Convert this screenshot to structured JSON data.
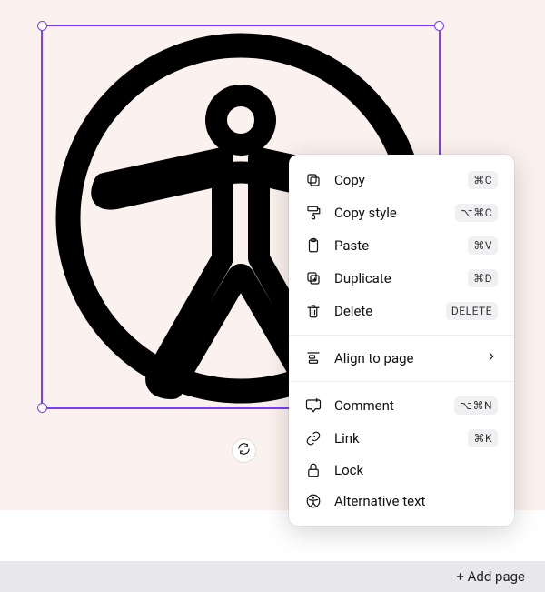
{
  "menu": {
    "copy": {
      "label": "Copy",
      "shortcut": "⌘C"
    },
    "copy_style": {
      "label": "Copy style",
      "shortcut": "⌥⌘C"
    },
    "paste": {
      "label": "Paste",
      "shortcut": "⌘V"
    },
    "duplicate": {
      "label": "Duplicate",
      "shortcut": "⌘D"
    },
    "delete": {
      "label": "Delete",
      "shortcut": "DELETE"
    },
    "align": {
      "label": "Align to page"
    },
    "comment": {
      "label": "Comment",
      "shortcut": "⌥⌘N"
    },
    "link": {
      "label": "Link",
      "shortcut": "⌘K"
    },
    "lock": {
      "label": "Lock"
    },
    "alt": {
      "label": "Alternative text"
    }
  },
  "footer": {
    "add_page": "+ Add page"
  }
}
